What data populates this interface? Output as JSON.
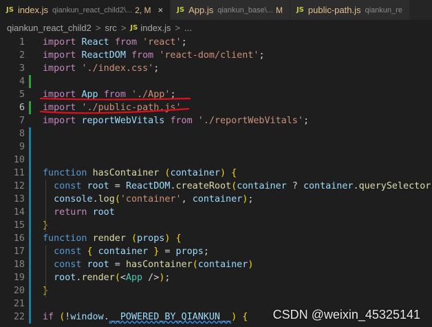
{
  "tabs": [
    {
      "icon": "JS",
      "name": "index.js",
      "path": "qiankun_react_child2\\...",
      "status": "2, M",
      "close": "×",
      "active": true
    },
    {
      "icon": "JS",
      "name": "App.js",
      "path": "qiankun_base\\...",
      "status": "M",
      "active": false
    },
    {
      "icon": "JS",
      "name": "public-path.js",
      "path": "qiankun_re",
      "status": "",
      "active": false
    }
  ],
  "breadcrumb": {
    "items": [
      "qiankun_react_child2",
      "src",
      "index.js",
      "..."
    ],
    "separator": ">",
    "file_icon": "JS"
  },
  "editor": {
    "lines": [
      {
        "n": "1",
        "code": "import React from 'react';"
      },
      {
        "n": "2",
        "code": "import ReactDOM from 'react-dom/client';"
      },
      {
        "n": "3",
        "code": "import './index.css';"
      },
      {
        "n": "4",
        "code": ""
      },
      {
        "n": "5",
        "code": "import App from './App';"
      },
      {
        "n": "6",
        "code": "import './public-path.js'"
      },
      {
        "n": "7",
        "code": "import reportWebVitals from './reportWebVitals';"
      },
      {
        "n": "8",
        "code": ""
      },
      {
        "n": "9",
        "code": ""
      },
      {
        "n": "10",
        "code": ""
      },
      {
        "n": "11",
        "code": "function hasContainer (container) {"
      },
      {
        "n": "12",
        "code": "  const root = ReactDOM.createRoot(container ? container.querySelector('#r"
      },
      {
        "n": "13",
        "code": "  console.log('container', container);"
      },
      {
        "n": "14",
        "code": "  return root"
      },
      {
        "n": "15",
        "code": "}"
      },
      {
        "n": "16",
        "code": "function render (props) {"
      },
      {
        "n": "17",
        "code": "  const { container } = props;"
      },
      {
        "n": "18",
        "code": "  const root = hasContainer(container)"
      },
      {
        "n": "19",
        "code": "  root.render(<App />);"
      },
      {
        "n": "20",
        "code": "}"
      },
      {
        "n": "21",
        "code": ""
      },
      {
        "n": "22",
        "code": "if (!window.__POWERED_BY_QIANKUN__) {"
      }
    ],
    "current_line": "6"
  },
  "watermark": "CSDN @weixin_45325141",
  "colors": {
    "annotation": "#e0101c",
    "keyword": "#569cd6",
    "string": "#ce9178",
    "variable": "#9cdcfe",
    "function": "#dcdcaa",
    "control": "#c586c0"
  }
}
